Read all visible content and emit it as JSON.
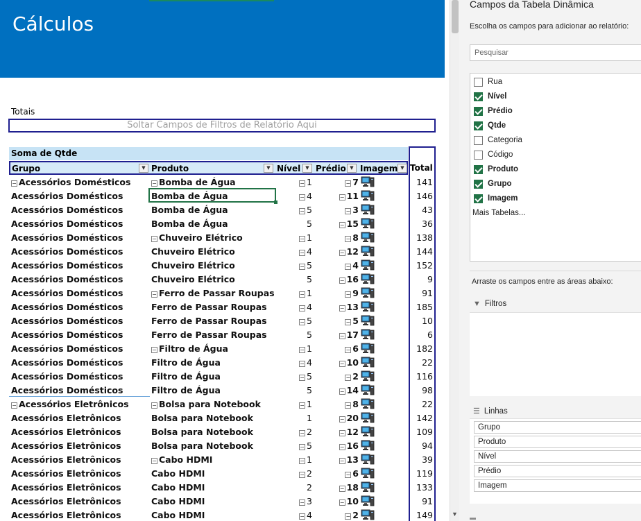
{
  "sheet": {
    "title": "Cálculos",
    "totais_label": "Totais",
    "filter_drop_label": "Soltar Campos de Filtros de Relatório Aqui",
    "pivot": {
      "title": "Soma de Qtde",
      "headers": {
        "grupo": "Grupo",
        "produto": "Produto",
        "nivel": "Nível",
        "predio": "Prédio",
        "imagem": "Imagem",
        "total": "Total"
      },
      "rows": [
        {
          "grupo": "Acessórios Domésticos",
          "g_pm": true,
          "produto": "Bomba de Água",
          "p_pm": true,
          "nivel": "1",
          "n_pm": true,
          "predio": "7",
          "pr_pm": true,
          "total": "141"
        },
        {
          "grupo": "Acessórios Domésticos",
          "produto": "Bomba de Água",
          "nivel": "4",
          "n_pm": true,
          "predio": "11",
          "pr_pm": true,
          "total": "146"
        },
        {
          "grupo": "Acessórios Domésticos",
          "produto": "Bomba de Água",
          "nivel": "5",
          "n_pm": true,
          "predio": "3",
          "pr_pm": true,
          "total": "43"
        },
        {
          "grupo": "Acessórios Domésticos",
          "produto": "Bomba de Água",
          "nivel": "5",
          "predio": "15",
          "pr_pm": true,
          "total": "36"
        },
        {
          "grupo": "Acessórios Domésticos",
          "produto": "Chuveiro Elétrico",
          "p_pm": true,
          "nivel": "1",
          "n_pm": true,
          "predio": "8",
          "pr_pm": true,
          "total": "138"
        },
        {
          "grupo": "Acessórios Domésticos",
          "produto": "Chuveiro Elétrico",
          "nivel": "4",
          "n_pm": true,
          "predio": "12",
          "pr_pm": true,
          "total": "144"
        },
        {
          "grupo": "Acessórios Domésticos",
          "produto": "Chuveiro Elétrico",
          "nivel": "5",
          "n_pm": true,
          "predio": "4",
          "pr_pm": true,
          "total": "152"
        },
        {
          "grupo": "Acessórios Domésticos",
          "produto": "Chuveiro Elétrico",
          "nivel": "5",
          "predio": "16",
          "pr_pm": true,
          "total": "9"
        },
        {
          "grupo": "Acessórios Domésticos",
          "produto": "Ferro de Passar Roupas",
          "p_pm": true,
          "nivel": "1",
          "n_pm": true,
          "predio": "9",
          "pr_pm": true,
          "total": "91"
        },
        {
          "grupo": "Acessórios Domésticos",
          "produto": "Ferro de Passar Roupas",
          "nivel": "4",
          "n_pm": true,
          "predio": "13",
          "pr_pm": true,
          "total": "185"
        },
        {
          "grupo": "Acessórios Domésticos",
          "produto": "Ferro de Passar Roupas",
          "nivel": "5",
          "n_pm": true,
          "predio": "5",
          "pr_pm": true,
          "total": "10"
        },
        {
          "grupo": "Acessórios Domésticos",
          "produto": "Ferro de Passar Roupas",
          "nivel": "5",
          "predio": "17",
          "pr_pm": true,
          "total": "6"
        },
        {
          "grupo": "Acessórios Domésticos",
          "produto": "Filtro de Água",
          "p_pm": true,
          "nivel": "1",
          "n_pm": true,
          "predio": "6",
          "pr_pm": true,
          "total": "182"
        },
        {
          "grupo": "Acessórios Domésticos",
          "produto": "Filtro de Água",
          "nivel": "4",
          "n_pm": true,
          "predio": "10",
          "pr_pm": true,
          "total": "22"
        },
        {
          "grupo": "Acessórios Domésticos",
          "produto": "Filtro de Água",
          "nivel": "5",
          "n_pm": true,
          "predio": "2",
          "pr_pm": true,
          "total": "116"
        },
        {
          "grupo": "Acessórios Domésticos",
          "produto": "Filtro de Água",
          "nivel": "5",
          "predio": "14",
          "pr_pm": true,
          "total": "98"
        },
        {
          "grupo": "Acessórios Eletrônicos",
          "g_pm": true,
          "produto": "Bolsa para Notebook",
          "p_pm": true,
          "nivel": "1",
          "n_pm": true,
          "predio": "8",
          "pr_pm": true,
          "total": "22"
        },
        {
          "grupo": "Acessórios Eletrônicos",
          "produto": "Bolsa para Notebook",
          "nivel": "1",
          "predio": "20",
          "pr_pm": true,
          "total": "142"
        },
        {
          "grupo": "Acessórios Eletrônicos",
          "produto": "Bolsa para Notebook",
          "nivel": "2",
          "n_pm": true,
          "predio": "12",
          "pr_pm": true,
          "total": "109"
        },
        {
          "grupo": "Acessórios Eletrônicos",
          "produto": "Bolsa para Notebook",
          "nivel": "5",
          "n_pm": true,
          "predio": "16",
          "pr_pm": true,
          "total": "94"
        },
        {
          "grupo": "Acessórios Eletrônicos",
          "produto": "Cabo HDMI",
          "p_pm": true,
          "nivel": "1",
          "n_pm": true,
          "predio": "13",
          "pr_pm": true,
          "total": "39"
        },
        {
          "grupo": "Acessórios Eletrônicos",
          "produto": "Cabo HDMI",
          "nivel": "2",
          "n_pm": true,
          "predio": "6",
          "pr_pm": true,
          "total": "119"
        },
        {
          "grupo": "Acessórios Eletrônicos",
          "produto": "Cabo HDMI",
          "nivel": "2",
          "predio": "18",
          "pr_pm": true,
          "total": "133"
        },
        {
          "grupo": "Acessórios Eletrônicos",
          "produto": "Cabo HDMI",
          "nivel": "3",
          "n_pm": true,
          "predio": "10",
          "pr_pm": true,
          "total": "91"
        },
        {
          "grupo": "Acessórios Eletrônicos",
          "produto": "Cabo HDMI",
          "nivel": "4",
          "n_pm": true,
          "predio": "2",
          "pr_pm": true,
          "total": "149"
        }
      ]
    }
  },
  "pane": {
    "title": "Campos da Tabela Dinâmica",
    "subtitle": "Escolha os campos para adicionar ao relatório:",
    "search_placeholder": "Pesquisar",
    "fields": [
      {
        "label": "Rua",
        "checked": false
      },
      {
        "label": "Nível",
        "checked": true
      },
      {
        "label": "Prédio",
        "checked": true
      },
      {
        "label": "Qtde",
        "checked": true
      },
      {
        "label": "Categoria",
        "checked": false
      },
      {
        "label": "Código",
        "checked": false
      },
      {
        "label": "Produto",
        "checked": true
      },
      {
        "label": "Grupo",
        "checked": true
      },
      {
        "label": "Imagem",
        "checked": true
      }
    ],
    "more_tables": "Mais Tabelas...",
    "drag_label": "Arraste os campos entre as áreas abaixo:",
    "filters_label": "Filtros",
    "lines_label": "Linhas",
    "lines": [
      "Grupo",
      "Produto",
      "Nível",
      "Prédio",
      "Imagem"
    ]
  },
  "colors": {
    "banner": "#0070c0",
    "pivot_border": "#1f1f8f",
    "selection": "#217346",
    "checkbox": "#217346"
  },
  "icons": {
    "image_cell": "computer-icon",
    "filter": "filter-icon",
    "rows": "rows-icon",
    "expand": "minus-box-icon"
  }
}
